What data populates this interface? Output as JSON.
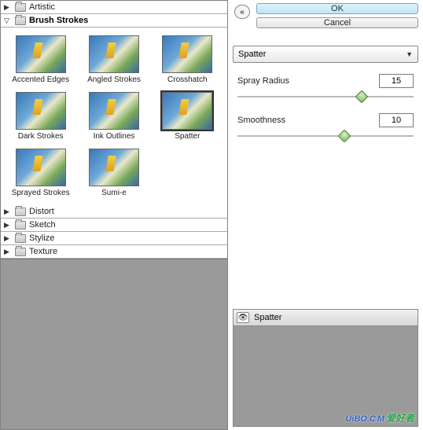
{
  "categories": {
    "artistic": "Artistic",
    "brush_strokes": "Brush Strokes",
    "distort": "Distort",
    "sketch": "Sketch",
    "stylize": "Stylize",
    "texture": "Texture"
  },
  "thumbs": [
    {
      "label": "Accented Edges"
    },
    {
      "label": "Angled Strokes"
    },
    {
      "label": "Crosshatch"
    },
    {
      "label": "Dark Strokes"
    },
    {
      "label": "Ink Outlines"
    },
    {
      "label": "Spatter"
    },
    {
      "label": "Sprayed Strokes"
    },
    {
      "label": "Sumi-e"
    }
  ],
  "buttons": {
    "ok": "OK",
    "cancel": "Cancel"
  },
  "filter_select": {
    "value": "Spatter"
  },
  "params": {
    "spray_radius": {
      "label": "Spray Radius",
      "value": "15",
      "pos": 68
    },
    "smoothness": {
      "label": "Smoothness",
      "value": "10",
      "pos": 58
    }
  },
  "layer": {
    "name": "Spatter"
  },
  "watermark": {
    "main": "UiBO.C",
    "suffix": "M",
    "cn": "爱好者"
  }
}
